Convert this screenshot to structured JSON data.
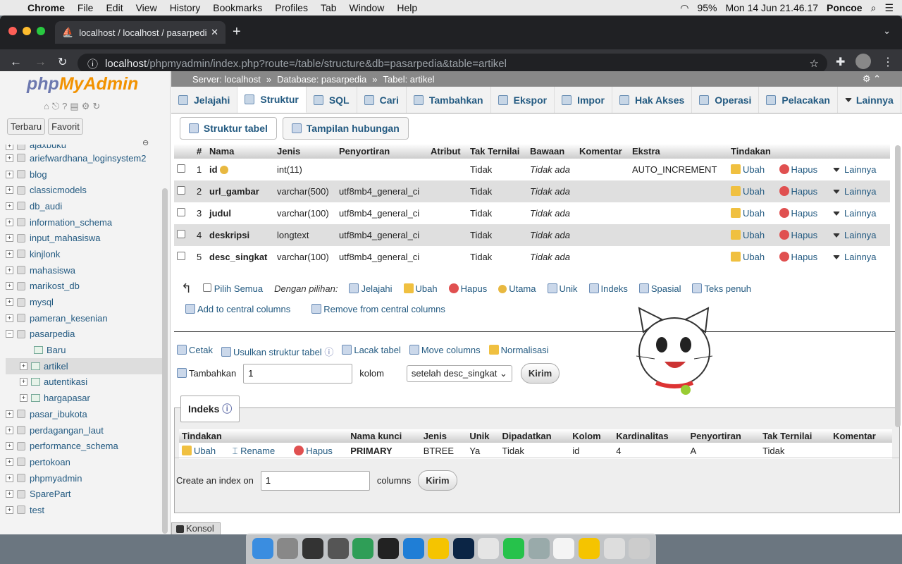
{
  "menubar": {
    "app": "Chrome",
    "items": [
      "File",
      "Edit",
      "View",
      "History",
      "Bookmarks",
      "Profiles",
      "Tab",
      "Window",
      "Help"
    ],
    "battery": "95%",
    "datetime": "Mon 14 Jun  21.46.17",
    "user": "Poncoe"
  },
  "browser": {
    "tab_title": "localhost / localhost / pasarpedi",
    "url_host": "localhost",
    "url_path": "/phpmyadmin/index.php?route=/table/structure&db=pasarpedia&table=artikel"
  },
  "sidebar": {
    "logo_a": "php",
    "logo_b": "MyAdmin",
    "btn_recent": "Terbaru",
    "btn_fav": "Favorit",
    "dbs": [
      "ajaxbuku",
      "ariefwardhana_loginsystem2",
      "blog",
      "classicmodels",
      "db_audi",
      "information_schema",
      "input_mahasiswa",
      "kinjlonk",
      "mahasiswa",
      "marikost_db",
      "mysql",
      "pameran_kesenian",
      "pasarpedia"
    ],
    "pasarpedia_children": [
      "Baru",
      "artikel",
      "autentikasi",
      "hargapasar"
    ],
    "dbs_after": [
      "pasar_ibukota",
      "perdagangan_laut",
      "performance_schema",
      "pertokoan",
      "phpmyadmin",
      "SparePart",
      "test"
    ]
  },
  "breadcrumb": {
    "server": "Server: localhost",
    "database": "Database: pasarpedia",
    "table": "Tabel: artikel"
  },
  "tabs": [
    "Jelajahi",
    "Struktur",
    "SQL",
    "Cari",
    "Tambahkan",
    "Ekspor",
    "Impor",
    "Hak Akses",
    "Operasi",
    "Pelacakan",
    "Lainnya"
  ],
  "subtabs": [
    "Struktur tabel",
    "Tampilan hubungan"
  ],
  "structure": {
    "headers": [
      "#",
      "Nama",
      "Jenis",
      "Penyortiran",
      "Atribut",
      "Tak Ternilai",
      "Bawaan",
      "Komentar",
      "Ekstra",
      "Tindakan"
    ],
    "rows": [
      {
        "n": "1",
        "name": "id",
        "type": "int(11)",
        "coll": "",
        "attr": "",
        "null": "Tidak",
        "def": "Tidak ada",
        "comment": "",
        "extra": "AUTO_INCREMENT"
      },
      {
        "n": "2",
        "name": "url_gambar",
        "type": "varchar(500)",
        "coll": "utf8mb4_general_ci",
        "attr": "",
        "null": "Tidak",
        "def": "Tidak ada",
        "comment": "",
        "extra": ""
      },
      {
        "n": "3",
        "name": "judul",
        "type": "varchar(100)",
        "coll": "utf8mb4_general_ci",
        "attr": "",
        "null": "Tidak",
        "def": "Tidak ada",
        "comment": "",
        "extra": ""
      },
      {
        "n": "4",
        "name": "deskripsi",
        "type": "longtext",
        "coll": "utf8mb4_general_ci",
        "attr": "",
        "null": "Tidak",
        "def": "Tidak ada",
        "comment": "",
        "extra": ""
      },
      {
        "n": "5",
        "name": "desc_singkat",
        "type": "varchar(100)",
        "coll": "utf8mb4_general_ci",
        "attr": "",
        "null": "Tidak",
        "def": "Tidak ada",
        "comment": "",
        "extra": ""
      }
    ],
    "act_edit": "Ubah",
    "act_drop": "Hapus",
    "act_more": "Lainnya"
  },
  "withsel": {
    "check_all": "Pilih Semua",
    "label": "Dengan pilihan:",
    "items": [
      "Jelajahi",
      "Ubah",
      "Hapus",
      "Utama",
      "Unik",
      "Indeks",
      "Spasial",
      "Teks penuh"
    ]
  },
  "central": {
    "add": "Add to central columns",
    "remove": "Remove from central columns"
  },
  "links2": [
    "Cetak",
    "Usulkan struktur tabel",
    "Lacak tabel",
    "Move columns",
    "Normalisasi"
  ],
  "addcols": {
    "label": "Tambahkan",
    "value": "1",
    "unit": "kolom",
    "position": "setelah desc_singkat",
    "submit": "Kirim"
  },
  "index": {
    "legend": "Indeks",
    "headers": [
      "Tindakan",
      "Nama kunci",
      "Jenis",
      "Unik",
      "Dipadatkan",
      "Kolom",
      "Kardinalitas",
      "Penyortiran",
      "Tak Ternilai",
      "Komentar"
    ],
    "row": {
      "edit": "Ubah",
      "rename": "Rename",
      "drop": "Hapus",
      "key": "PRIMARY",
      "type": "BTREE",
      "unique": "Ya",
      "packed": "Tidak",
      "column": "id",
      "card": "4",
      "coll": "A",
      "null": "Tidak",
      "comment": ""
    },
    "create_label": "Create an index on",
    "create_value": "1",
    "create_unit": "columns",
    "create_submit": "Kirim"
  },
  "konsol": "Konsol"
}
